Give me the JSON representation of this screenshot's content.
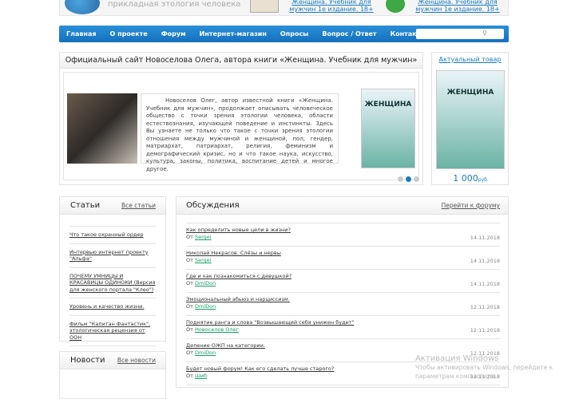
{
  "header": {
    "tagline": "прикладная этология человека",
    "promo1": "Женщина. Учебник для мужчин 1е издание. 18+",
    "promo2": "Женщина. Учебник для мужчин 1е издание. 18+"
  },
  "nav": {
    "items": [
      "Главная",
      "О проекте",
      "Форум",
      "Интернет-магазин",
      "Опросы",
      "Вопрос / Ответ",
      "Контакты"
    ],
    "search_placeholder": "Поиск"
  },
  "main": {
    "title": "Официальный сайт Новоселова Олега, автора книги «Женщина. Учебник для мужчин»",
    "text": "Новоселов Олег, автор известной книги «Женщина. Учебник для мужчин», продолжает описывать человеческое общество с точки зрения этологии человека, области естествознания, изучающей поведение и инстинкты. Здесь Вы узнаете не только что такое с точки зрения этологии отношения между мужчиной и женщиной, пол, гендер, матриархат, патриархат, религия, феминизм и демографический кризис, но и что такое наука, искусство, культура, законы, политика, воспитание детей и многое другое.",
    "book_title": "ЖЕНЩИНА"
  },
  "side": {
    "title": "Актуальный товар",
    "book_title": "ЖЕНЩИНА",
    "price": "1 000",
    "currency": "руб."
  },
  "articles": {
    "title": "Статьи",
    "all": "Все статьи",
    "items": [
      "Что такое охранный ордер",
      "Интервью интернет проекту \"Альфа\"",
      "ПОЧЕМУ УМНИЦЫ И КРАСАВИЦЫ ОДИНОКИ (Версия для женского портала \"Клео\")",
      "Уровень и качество жизни.",
      "Фильм \"Капитан Фантастик\", этологическая рецензия от ООН"
    ]
  },
  "news": {
    "title": "Новости",
    "all": "Все новости"
  },
  "discussions": {
    "title": "Обсуждения",
    "all": "Перейти к форуму",
    "by": "От",
    "items": [
      {
        "title": "Как определить новые цели в жизни?",
        "author": "Sergei",
        "date": "14.11.2018"
      },
      {
        "title": "Николай Некрасов. Слёзы и нервы",
        "author": "Sergei",
        "date": "14.11.2018"
      },
      {
        "title": "Где и как познакомиться с девушкой?",
        "author": "DmiDon",
        "date": "14.11.2018"
      },
      {
        "title": "Эмоциональный абьюз и нарциссизм.",
        "author": "DmiDon",
        "date": "12.11.2018"
      },
      {
        "title": "Поднятие ранга и слова \"Возвышающий себя унижен будет\"",
        "author": "Новоселов Олег",
        "date": "12.11.2018"
      },
      {
        "title": "Деление ОЖП на категории.",
        "author": "DmiDon",
        "date": "12.11.2018"
      },
      {
        "title": "Будет новый форум! Как его сделать лучше старого?",
        "author": "Шиб",
        "date": "11.11.2018"
      }
    ]
  },
  "watermark": {
    "title": "Активация Windows",
    "text": "Чтобы активировать Windows, перейдите к параметрам компьютера."
  }
}
